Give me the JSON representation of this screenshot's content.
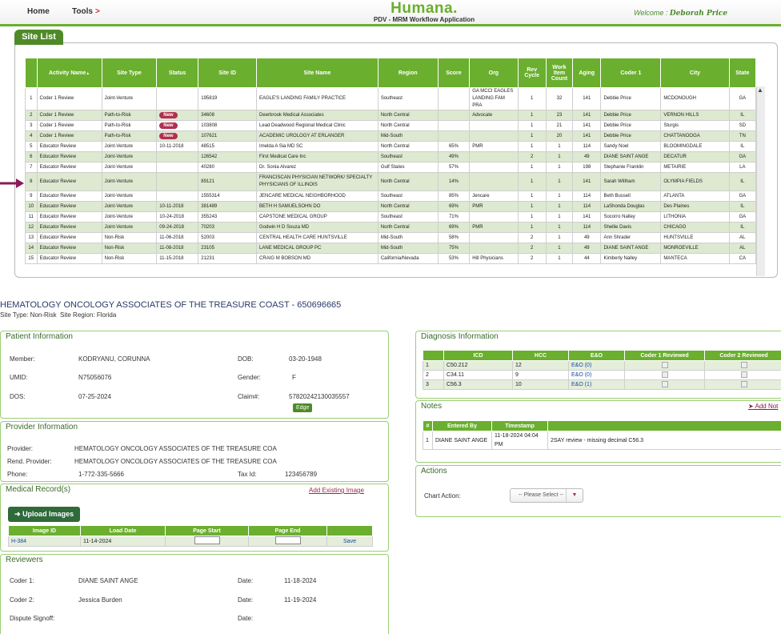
{
  "nav": {
    "home": "Home",
    "tools": "Tools",
    "tools_chevron": ">"
  },
  "brand": {
    "logo": "Humana.",
    "subtitle": "PDV - MRM Workflow Application"
  },
  "welcome": {
    "label": "Welcome :",
    "user": "Deborah Price"
  },
  "site_list": {
    "tab": "Site List",
    "columns": [
      "",
      "Activity Name",
      "Site Type",
      "Status",
      "Site ID",
      "Site Name",
      "Region",
      "Score",
      "Org",
      "Rev Cycle",
      "Work Item Count",
      "Aging",
      "Coder 1",
      "City",
      "State"
    ],
    "sort_indicator": "▲",
    "rows": [
      [
        "1",
        "Coder 1 Review",
        "Joint-Venture",
        "",
        "195819",
        "EAGLE'S LANDING FAMILY PRACTICE",
        "Southeast",
        "",
        "GA MCCI EAGLES LANDING FAM PRA",
        "1",
        "32",
        "141",
        "Debbie Price",
        "MCDONOUGH",
        "GA"
      ],
      [
        "2",
        "Coder 1 Review",
        "Path-to-Risk",
        "New",
        "34608",
        "Deerbrook Medical Associates",
        "North Central",
        "",
        "Advocate",
        "1",
        "23",
        "141",
        "Debbie Price",
        "VERNON HILLS",
        "IL"
      ],
      [
        "3",
        "Coder 1 Review",
        "Path-to-Risk",
        "New",
        "103808",
        "Lead Deadwood Regional Medical Clinic",
        "North Central",
        "",
        "",
        "1",
        "21",
        "141",
        "Debbie Price",
        "Sturgis",
        "SD"
      ],
      [
        "4",
        "Coder 1 Review",
        "Path-to-Risk",
        "New",
        "107621",
        "ACADEMIC UROLOGY AT ERLANGER",
        "Mid-South",
        "",
        "",
        "1",
        "20",
        "141",
        "Debbie Price",
        "CHATTANOOGA",
        "TN"
      ],
      [
        "5",
        "Educator Review",
        "Joint-Venture",
        "10-11-2018",
        "48515",
        "Imelda A Sia MD SC",
        "North Central",
        "65%",
        "PMR",
        "1",
        "1",
        "114",
        "Sandy Noel",
        "BLOOMINGDALE",
        "IL"
      ],
      [
        "6",
        "Educator Review",
        "Joint-Venture",
        "",
        "126542",
        "First Medical Care Inc",
        "Southeast",
        "49%",
        "",
        "2",
        "1",
        "49",
        "DIANE SAINT ANGE",
        "DECATUR",
        "GA"
      ],
      [
        "7",
        "Educator Review",
        "Joint-Venture",
        "",
        "40280",
        "Dr. Sonia Alvarez",
        "Gulf States",
        "57%",
        "",
        "1",
        "1",
        "198",
        "Stephanie Franklin",
        "METAIRIE",
        "LA"
      ],
      [
        "8",
        "Educator Review",
        "Joint-Venture",
        "",
        "89121",
        "FRANCISCAN PHYSICIAN NETWORK/ SPECIALTY PHYSICIANS OF ILLINOIS",
        "North Central",
        "14%",
        "",
        "1",
        "1",
        "141",
        "Sarah Willham",
        "OLYMPIA FIELDS",
        "IL"
      ],
      [
        "9",
        "Educator Review",
        "Joint-Venture",
        "",
        "1555314",
        "JENCARE MEDICAL NEIGHBORHOOD",
        "Southeast",
        "85%",
        "Jencare",
        "1",
        "1",
        "114",
        "Beth Bussell",
        "ATLANTA",
        "GA"
      ],
      [
        "10",
        "Educator Review",
        "Joint-Venture",
        "10-11-2018",
        "381489",
        "BETH H SAMUELSOHN DO",
        "North Central",
        "69%",
        "PMR",
        "1",
        "1",
        "114",
        "LaShonda Douglas",
        "Des Plaines",
        "IL"
      ],
      [
        "11",
        "Educator Review",
        "Joint-Venture",
        "10-24-2018",
        "355243",
        "CAPSTONE MEDICAL GROUP",
        "Southeast",
        "71%",
        "",
        "1",
        "1",
        "141",
        "Socorro Nalley",
        "LITHONIA",
        "GA"
      ],
      [
        "12",
        "Educator Review",
        "Joint-Venture",
        "09-24-2018",
        "70203",
        "Godwin H D Souza MD",
        "North Central",
        "69%",
        "PMR",
        "1",
        "1",
        "114",
        "Shellie Davis",
        "CHICAGO",
        "IL"
      ],
      [
        "13",
        "Educator Review",
        "Non-Risk",
        "11-06-2018",
        "52003",
        "CENTRAL HEALTH CARE HUNTSVILLE",
        "Mid-South",
        "58%",
        "",
        "2",
        "1",
        "49",
        "Ann Shrader",
        "HUNTSVILLE",
        "AL"
      ],
      [
        "14",
        "Educator Review",
        "Non-Risk",
        "11-08-2018",
        "23105",
        "LANE MEDICAL GROUP PC",
        "Mid-South",
        "75%",
        "",
        "2",
        "1",
        "49",
        "DIANE SAINT ANGE",
        "MONROEVILLE",
        "AL"
      ],
      [
        "15",
        "Educator Review",
        "Non-Risk",
        "11-15-2018",
        "21231",
        "CRAIG M BOBSON MD",
        "California/Nevada",
        "53%",
        "Hill Physicians",
        "2",
        "1",
        "44",
        "Kimberly Nalley",
        "MANTECA",
        "CA"
      ]
    ]
  },
  "detail": {
    "title": "HEMATOLOGY ONCOLOGY ASSOCIATES OF THE TREASURE COAST - 650696665",
    "site_type_label": "Site Type:",
    "site_type": "Non-Risk",
    "site_region_label": "Site Region:",
    "site_region": "Florida"
  },
  "patient": {
    "title": "Patient Information",
    "member_label": "Member:",
    "member": "KODRYANU, CORUNNA",
    "dob_label": "DOB:",
    "dob": "03-20-1948",
    "umid_label": "UMID:",
    "umid": "N75056076",
    "gender_label": "Gender:",
    "gender": "F",
    "dos_label": "DOS:",
    "dos": "07-25-2024",
    "claim_label": "Claim#:",
    "claim": "57820242130035557",
    "edge": "Edge"
  },
  "provider": {
    "title": "Provider Information",
    "provider_label": "Provider:",
    "provider": "HEMATOLOGY ONCOLOGY ASSOCIATES OF THE TREASURE COA",
    "rend_label": "Rend. Provider:",
    "rend": "HEMATOLOGY ONCOLOGY ASSOCIATES OF THE TREASURE COA",
    "phone_label": "Phone:",
    "phone": "1-772-335-5666",
    "taxid_label": "Tax Id:",
    "taxid": "123456789"
  },
  "records": {
    "title": "Medical Record(s)",
    "add_existing": "Add Existing Image",
    "upload": "Upload Images",
    "columns": [
      "Image ID",
      "Load Date",
      "Page Start",
      "Page End",
      ""
    ],
    "row": {
      "image_id": "H-384",
      "load_date": "11-14-2024",
      "save": "Save"
    }
  },
  "reviewers": {
    "title": "Reviewers",
    "coder1_label": "Coder 1:",
    "coder1": "DIANE SAINT ANGE",
    "date1_label": "Date:",
    "date1": "11-18-2024",
    "coder2_label": "Coder 2:",
    "coder2": "Jessica Burden",
    "date2_label": "Date:",
    "date2": "11-19-2024",
    "dispute_label": "Dispute Signoff:",
    "date3_label": "Date:"
  },
  "diagnosis": {
    "title": "Diagnosis Information",
    "columns": [
      "",
      "ICD",
      "HCC",
      "E&O",
      "Coder 1 Reviewed",
      "Coder 2 Reviewed"
    ],
    "rows": [
      [
        "1",
        "C50.212",
        "12",
        "E&O (0)"
      ],
      [
        "2",
        "C34.11",
        "9",
        "E&O (0)"
      ],
      [
        "3",
        "C56.3",
        "10",
        "E&O (1)"
      ]
    ]
  },
  "notes": {
    "title": "Notes",
    "add": "Add Not",
    "columns": [
      "#",
      "Entered By",
      "Timestamp",
      ""
    ],
    "row": {
      "num": "1",
      "by": "DIANE SAINT ANGE",
      "ts": "11-18-2024 04:04 PM",
      "text": "2SAY review - missing decimal C56.3"
    }
  },
  "actions": {
    "title": "Actions",
    "chart_action_label": "Chart Action:",
    "select_value": "-- Please Select --"
  }
}
